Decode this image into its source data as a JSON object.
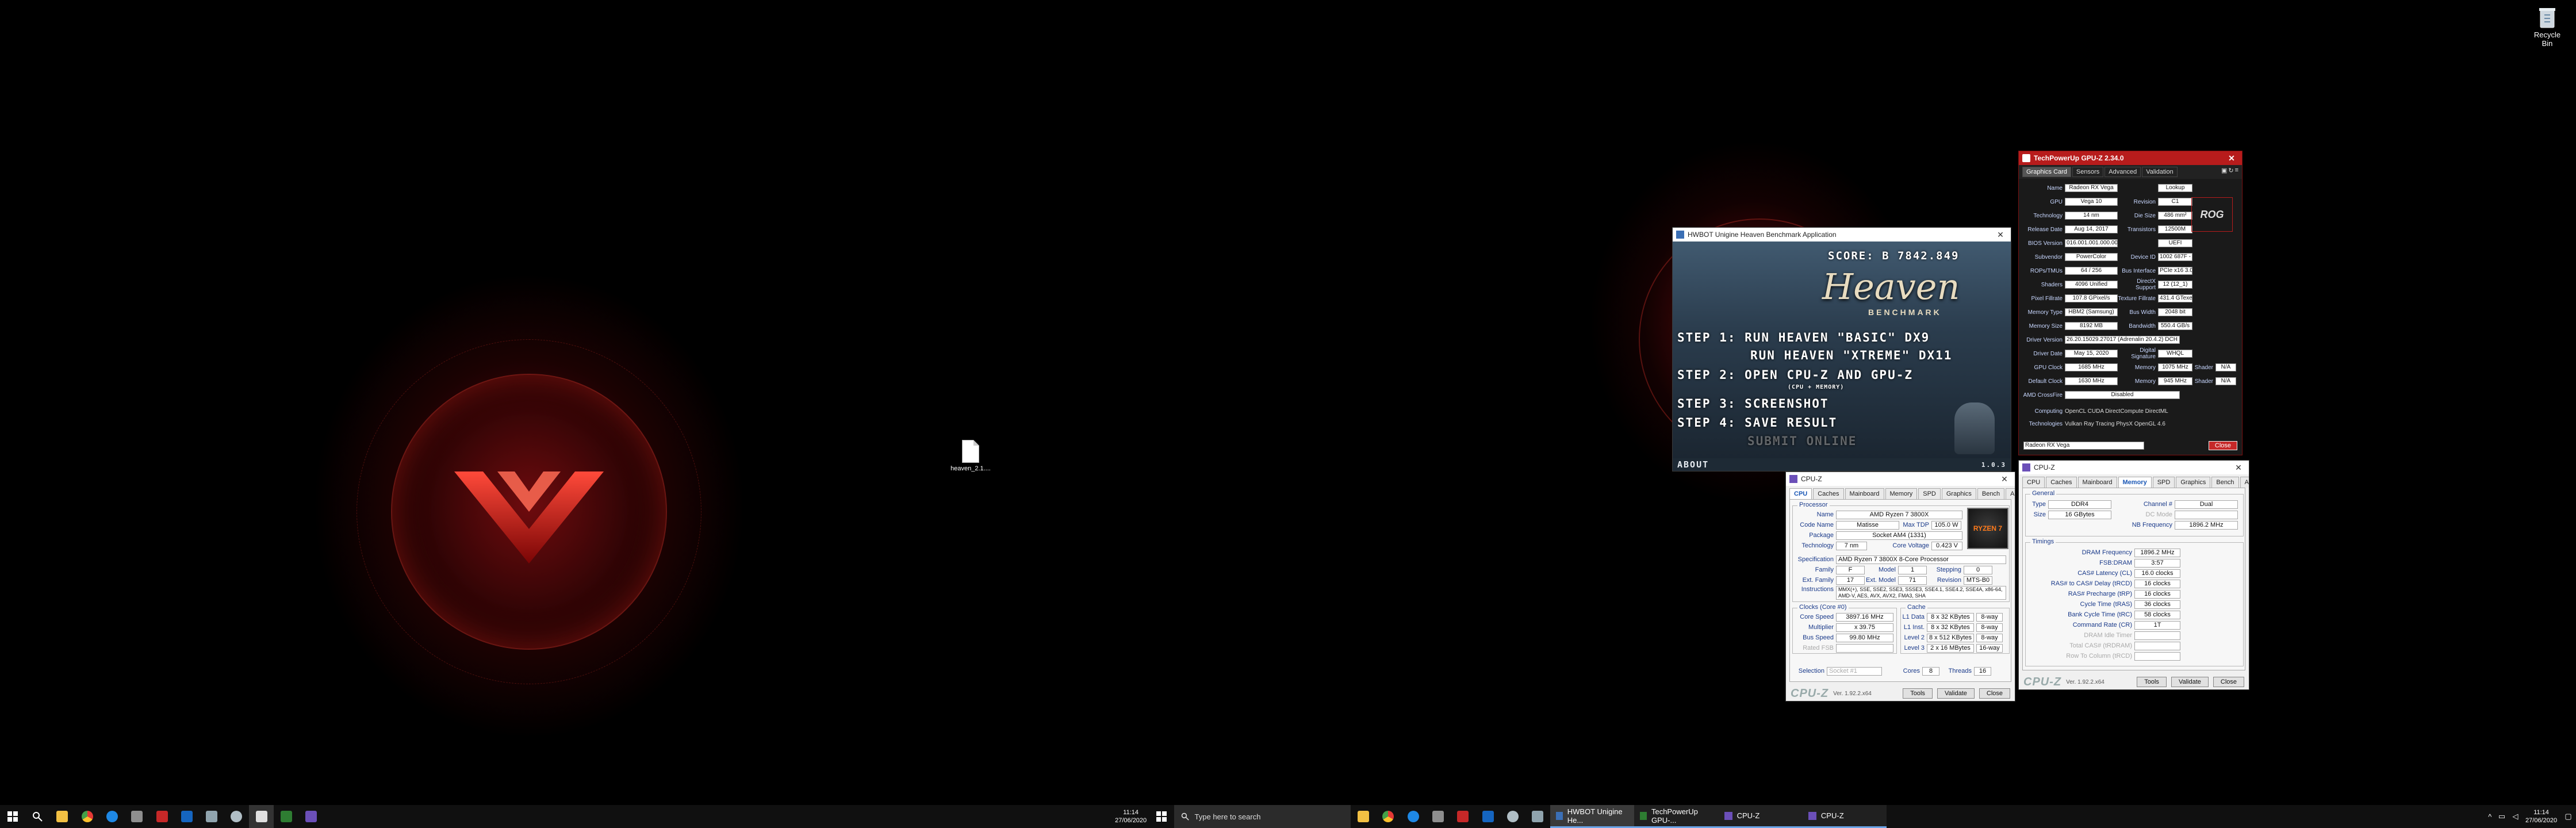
{
  "desktop": {
    "recycle_bin_label": "Recycle Bin",
    "file_label": "heaven_2.1....",
    "accent": "#cc1a1a"
  },
  "heaven": {
    "title": "HWBOT Unigine Heaven Benchmark Application",
    "score": "SCORE: B 7842.849",
    "logo": "Heaven",
    "logo_sub": "BENCHMARK",
    "step1_a": "STEP 1: RUN HEAVEN \"BASIC\" DX9",
    "step1_b": "RUN HEAVEN \"XTREME\" DX11",
    "step2": "STEP 2: OPEN CPU-Z AND GPU-Z",
    "step2_sub": "(CPU + MEMORY)",
    "step3": "STEP 3: SCREENSHOT",
    "step4": "STEP 4: SAVE RESULT",
    "step4_b": "SUBMIT ONLINE",
    "about": "ABOUT",
    "version": "1.0.3"
  },
  "cpuz_cpu": {
    "title": "CPU-Z",
    "tabs": [
      "CPU",
      "Caches",
      "Mainboard",
      "Memory",
      "SPD",
      "Graphics",
      "Bench",
      "About"
    ],
    "processor_group": "Processor",
    "name_label": "Name",
    "name": "AMD Ryzen 7 3800X",
    "codename_label": "Code Name",
    "codename": "Matisse",
    "maxtdp_label": "Max TDP",
    "maxtdp": "105.0 W",
    "package_label": "Package",
    "package": "Socket AM4 (1331)",
    "tech_label": "Technology",
    "tech": "7 nm",
    "voltage_label": "Core Voltage",
    "voltage": "0.423 V",
    "spec_label": "Specification",
    "spec": "AMD Ryzen 7 3800X 8-Core Processor",
    "family_label": "Family",
    "family": "F",
    "model_label": "Model",
    "model": "1",
    "stepping_label": "Stepping",
    "stepping": "0",
    "extfamily_label": "Ext. Family",
    "extfamily": "17",
    "extmodel_label": "Ext. Model",
    "extmodel": "71",
    "revision_label": "Revision",
    "revision": "MTS-B0",
    "instr_label": "Instructions",
    "instr": "MMX(+), SSE, SSE2, SSE3, SSSE3, SSE4.1, SSE4.2, SSE4A, x86-64, AMD-V, AES, AVX, AVX2, FMA3, SHA",
    "clocks_group": "Clocks (Core #0)",
    "corespeed_label": "Core Speed",
    "corespeed": "3897.16 MHz",
    "mult_label": "Multiplier",
    "mult": "x 39.75",
    "bus_label": "Bus Speed",
    "bus": "99.80 MHz",
    "fsb_label": "Rated FSB",
    "fsb": "",
    "cache_group": "Cache",
    "l1d_label": "L1 Data",
    "l1d": "8 x 32 KBytes",
    "l1d_w": "8-way",
    "l1i_label": "L1 Inst.",
    "l1i": "8 x 32 KBytes",
    "l1i_w": "8-way",
    "l2_label": "Level 2",
    "l2": "8 x 512 KBytes",
    "l2_w": "8-way",
    "l3_label": "Level 3",
    "l3": "2 x 16 MBytes",
    "l3_w": "16-way",
    "selection_label": "Selection",
    "selection": "Socket #1",
    "cores_label": "Cores",
    "cores": "8",
    "threads_label": "Threads",
    "threads": "16",
    "brand": "CPU-Z",
    "ver": "Ver. 1.92.2.x64",
    "tools": "Tools",
    "validate": "Validate",
    "close": "Close",
    "badge": "RYZEN 7"
  },
  "cpuz_mem": {
    "title": "CPU-Z",
    "tabs": [
      "CPU",
      "Caches",
      "Mainboard",
      "Memory",
      "SPD",
      "Graphics",
      "Bench",
      "About"
    ],
    "general_group": "General",
    "type_label": "Type",
    "type": "DDR4",
    "channel_label": "Channel #",
    "channel": "Dual",
    "size_label": "Size",
    "size": "16 GBytes",
    "dcmode_label": "DC Mode",
    "dcmode": "",
    "nbfreq_label": "NB Frequency",
    "nbfreq": "1896.2 MHz",
    "timings_group": "Timings",
    "dram_label": "DRAM Frequency",
    "dram": "1896.2 MHz",
    "fsbdram_label": "FSB:DRAM",
    "fsbdram": "3:57",
    "cl_label": "CAS# Latency (CL)",
    "cl": "16.0 clocks",
    "trcd_label": "RAS# to CAS# Delay (tRCD)",
    "trcd": "16 clocks",
    "trp_label": "RAS# Precharge (tRP)",
    "trp": "16 clocks",
    "tras_label": "Cycle Time (tRAS)",
    "tras": "36 clocks",
    "trc_label": "Bank Cycle Time (tRC)",
    "trc": "58 clocks",
    "cr_label": "Command Rate (CR)",
    "cr": "1T",
    "idle_label": "DRAM Idle Timer",
    "rdram_label": "Total CAS# (tRDRAM)",
    "trcd2_label": "Row To Column (tRCD)",
    "brand": "CPU-Z",
    "ver": "Ver. 1.92.2.x64",
    "tools": "Tools",
    "validate": "Validate",
    "close": "Close"
  },
  "gpuz": {
    "title": "TechPowerUp GPU-Z 2.34.0",
    "tabs": [
      "Graphics Card",
      "Sensors",
      "Advanced",
      "Validation"
    ],
    "rows": [
      {
        "l": "Name",
        "v": "Radeon RX Vega",
        "l2": "",
        "v2": "Lookup"
      },
      {
        "l": "GPU",
        "v": "Vega 10",
        "l2": "Revision",
        "v2": "C1"
      },
      {
        "l": "Technology",
        "v": "14 nm",
        "l2": "Die Size",
        "v2": "486 mm²"
      },
      {
        "l": "Release Date",
        "v": "Aug 14, 2017",
        "l2": "Transistors",
        "v2": "12500M"
      },
      {
        "l": "BIOS Version",
        "v": "016.001.001.000.000000",
        "l2": "",
        "v2": "UEFI"
      },
      {
        "l": "Subvendor",
        "v": "PowerColor",
        "l2": "Device ID",
        "v2": "1002 687F - 148C 2388"
      },
      {
        "l": "ROPs/TMUs",
        "v": "64 / 256",
        "l2": "Bus Interface",
        "v2": "PCIe x16 3.0 @ x16 3.0"
      },
      {
        "l": "Shaders",
        "v": "4096 Unified",
        "l2": "DirectX Support",
        "v2": "12 (12_1)"
      },
      {
        "l": "Pixel Fillrate",
        "v": "107.8 GPixel/s",
        "l2": "Texture Fillrate",
        "v2": "431.4 GTexel/s"
      },
      {
        "l": "Memory Type",
        "v": "HBM2 (Samsung)",
        "l2": "Bus Width",
        "v2": "2048 bit"
      },
      {
        "l": "Memory Size",
        "v": "8192 MB",
        "l2": "Bandwidth",
        "v2": "550.4 GB/s"
      },
      {
        "l": "Driver Version",
        "v": "26.20.15029.27017 (Adrenalin 20.4.2) DCH / Win10 64",
        "l2": "",
        "v2": ""
      },
      {
        "l": "Driver Date",
        "v": "May 15, 2020",
        "l2": "Digital Signature",
        "v2": "WHQL"
      },
      {
        "l": "GPU Clock",
        "v": "1685 MHz",
        "l2": "Memory",
        "v2": "1075 MHz"
      },
      {
        "l": "Default Clock",
        "v": "1630 MHz",
        "l2": "Memory",
        "v2": "945 MHz"
      },
      {
        "l": "AMD CrossFire",
        "v": "Disabled",
        "l2": "",
        "v2": ""
      }
    ],
    "shader_label": "Shader",
    "shader_val": "N/A",
    "computing_label": "Computing",
    "computing": "OpenCL  CUDA  DirectCompute  DirectML",
    "tech_label": "Technologies",
    "tech": "Vulkan  Ray Tracing  PhysX  OpenGL 4.6",
    "select": "Radeon RX Vega",
    "close": "Close",
    "logo": "ROG"
  },
  "taskbar": {
    "left_time": "11:14",
    "left_date": "27/06/2020",
    "search_placeholder": "Type here to search",
    "tasks": [
      "HWBOT Unigine He...",
      "TechPowerUp GPU-...",
      "CPU-Z",
      "CPU-Z"
    ],
    "time": "11:14",
    "date": "27/06/2020",
    "accent": "#6aa3e6"
  }
}
